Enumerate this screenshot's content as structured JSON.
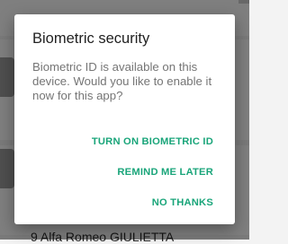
{
  "background": {
    "bottom_text": "9 Alfa Romeo GIULIETTA"
  },
  "dialog": {
    "title": "Biometric security",
    "message": "Biometric ID is available on this device. Would you like to enable it now for this app?",
    "actions": [
      {
        "label": "TURN ON BIOMETRIC ID"
      },
      {
        "label": "REMIND ME LATER"
      },
      {
        "label": "NO THANKS"
      }
    ]
  },
  "colors": {
    "accent": "#1aa57a",
    "title": "#212121",
    "message": "#757575"
  }
}
